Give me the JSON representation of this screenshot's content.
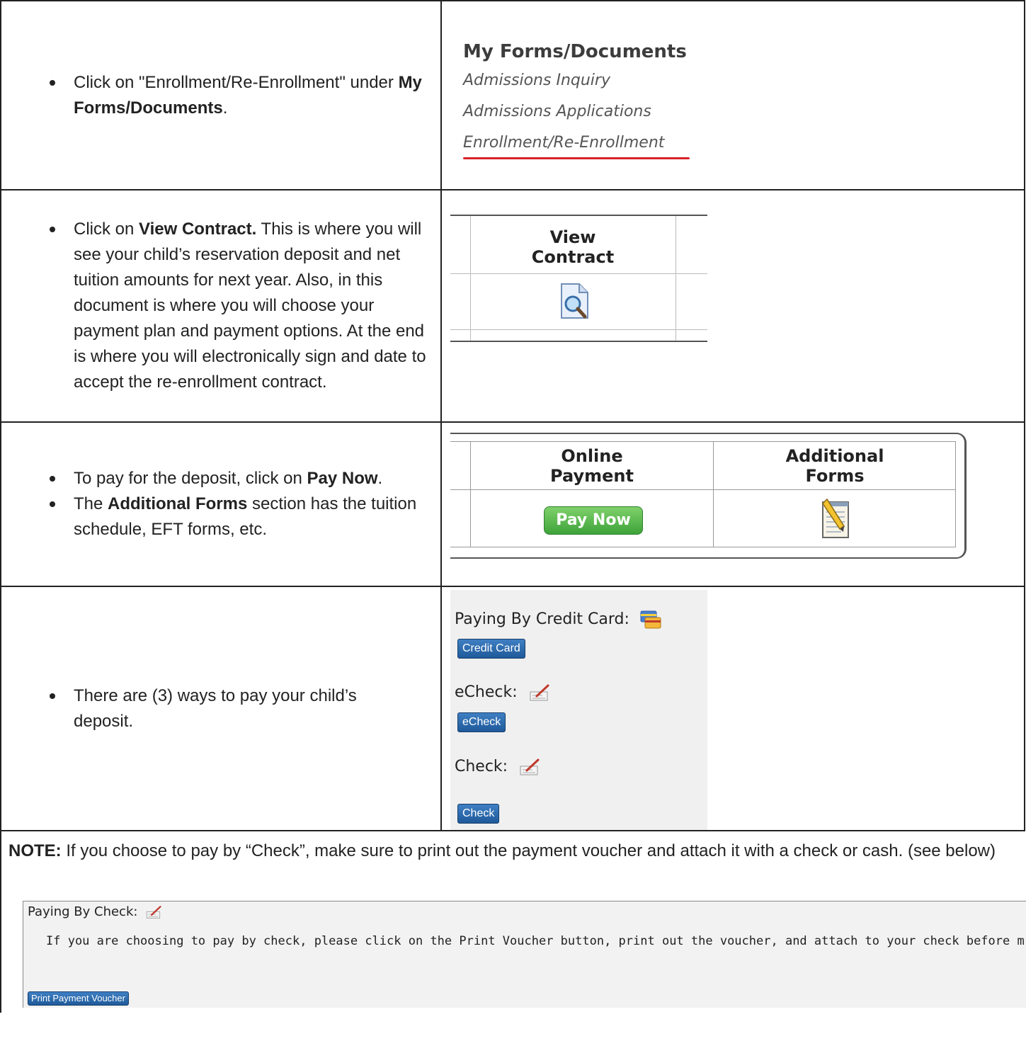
{
  "row1": {
    "instruction_prefix": "Click on \"Enrollment/Re-Enrollment\" under ",
    "instruction_bold": "My Forms/Documents",
    "instruction_suffix": ".",
    "forms_title": "My Forms/Documents",
    "links": [
      "Admissions Inquiry",
      "Admissions Applications",
      "Enrollment/Re-Enrollment"
    ]
  },
  "row2": {
    "instruction_prefix": "Click on ",
    "instruction_bold": "View Contract.",
    "instruction_suffix": "  This is where you will see your child’s reservation deposit and net tuition amounts for next year.  Also, in this document is where you will choose your payment plan and payment options.  At the end is where you will electronically sign and date to accept the re-enrollment contract.",
    "header_line1": "View",
    "header_line2": "Contract",
    "icon": "document-magnifier-icon"
  },
  "row3": {
    "item1_prefix": "To pay for the deposit, click on ",
    "item1_bold": "Pay Now",
    "item1_suffix": ".",
    "item2_prefix": "The ",
    "item2_bold": "Additional Forms",
    "item2_suffix": " section has the tuition schedule, EFT forms, etc.",
    "col1_line1": "Online",
    "col1_line2": "Payment",
    "col2_line1": "Additional",
    "col2_line2": "Forms",
    "pay_now": "Pay Now",
    "forms_icon": "notepad-pencil-icon"
  },
  "row4": {
    "instruction": "There are (3) ways to pay your child’s deposit.",
    "credit_label": "Paying By Credit Card:",
    "credit_button": "Credit Card",
    "echeck_label": "eCheck:",
    "echeck_button": "eCheck",
    "check_label": "Check:",
    "check_button": "Check"
  },
  "note": {
    "bold": "NOTE:",
    "text": "  If you choose to pay by “Check”, make sure to print out the payment voucher and attach it with a check or cash. (see below)",
    "check_label": "Paying By Check:",
    "check_desc": "If  you are choosing to pay by check, please click on the Print Voucher button,  print out the voucher, and attach to your check before m",
    "voucher_button": "Print Payment Voucher"
  },
  "colors": {
    "underline": "#d8232a",
    "pay_now_green": "#3ea33a",
    "button_blue": "#1f5a9a"
  }
}
